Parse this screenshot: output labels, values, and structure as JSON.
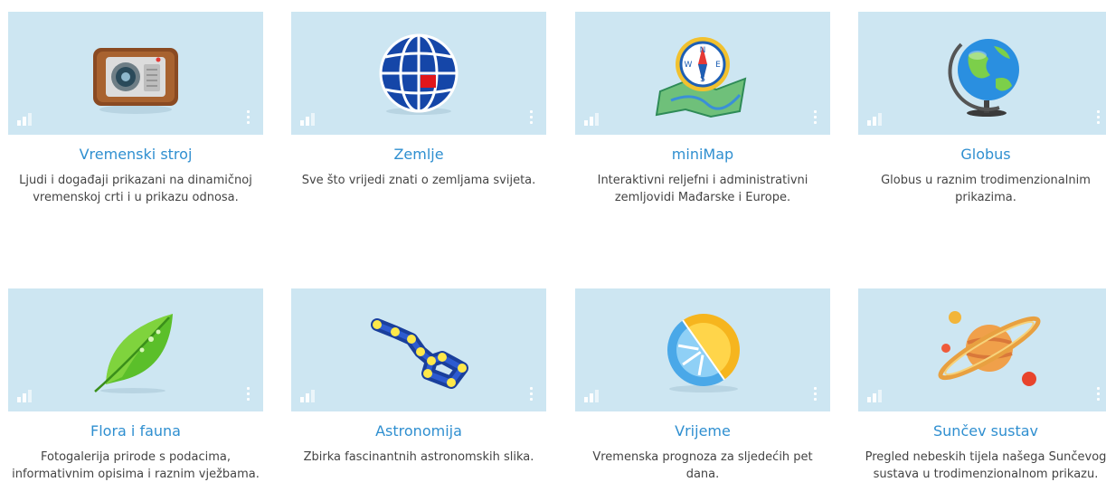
{
  "apps": [
    {
      "title": "Vremenski stroj",
      "description": "Ljudi i događaji prikazani na dinamičnoj vremenskoj crti i u prikazu odnosa.",
      "icon": "radio-time-machine-icon"
    },
    {
      "title": "Zemlje",
      "description": "Sve što vrijedi znati o zemljama svijeta.",
      "icon": "globe-grid-icon"
    },
    {
      "title": "miniMap",
      "description": "Interaktivni reljefni i administrativni zemljovidi Mađarske i Europe.",
      "icon": "compass-map-icon"
    },
    {
      "title": "Globus",
      "description": "Globus u raznim trodimenzionalnim prikazima.",
      "icon": "desk-globe-icon"
    },
    {
      "title": "Flora i fauna",
      "description": "Fotogalerija prirode s podacima, informativnim opisima i raznim vježbama.",
      "icon": "leaf-icon"
    },
    {
      "title": "Astronomija",
      "description": "Zbirka fascinantnih astronomskih slika.",
      "icon": "constellation-icon"
    },
    {
      "title": "Vrijeme",
      "description": "Vremenska prognoza za sljedećih pet dana.",
      "icon": "sun-snowflake-icon"
    },
    {
      "title": "Sunčev sustav",
      "description": "Pregled nebeskih tijela našega Sunčevog sustava u trodimenzionalnom prikazu.",
      "icon": "saturn-planets-icon"
    }
  ]
}
